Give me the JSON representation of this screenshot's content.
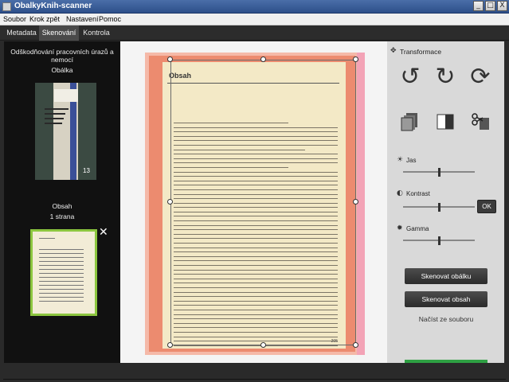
{
  "window": {
    "title": "ObalkyKnih-scanner",
    "buttons": [
      "_",
      "□",
      "X"
    ]
  },
  "menu": {
    "items": [
      "Soubor",
      "Krok zpět",
      "Nastavení",
      "Pomoc"
    ]
  },
  "tabs": [
    "Metadata",
    "Skenování",
    "Kontrola"
  ],
  "left_panel": {
    "title": "Odškodňování pracovních úrazů a nemocí",
    "cover_label": "Obálka",
    "cover_number": "13",
    "toc_label": "Obsah",
    "toc_pages": "1 strana",
    "remove_icon": "close-icon"
  },
  "center": {
    "page_heading": "Obsah",
    "page_number": "205"
  },
  "right_panel": {
    "transform_label": "Transformace",
    "rotate_left_icon": "rotate-left-icon",
    "rotate_right_icon": "rotate-right-icon",
    "refresh_icon": "refresh-icon",
    "brightness_label": "Jas",
    "contrast_label": "Kontrast",
    "gamma_label": "Gamma",
    "brightness_value": 0.5,
    "contrast_value": 0.5,
    "gamma_value": 0.5,
    "ok_label": "OK",
    "scan_cover_label": "Skenovat obálku",
    "scan_toc_label": "Skenovat obsah",
    "load_file_label": "Načíst ze souboru"
  },
  "colors": {
    "accent_green": "#8cc63f",
    "progress_green": "#2ea043",
    "titlebar_blue": "#2d4f8a"
  }
}
